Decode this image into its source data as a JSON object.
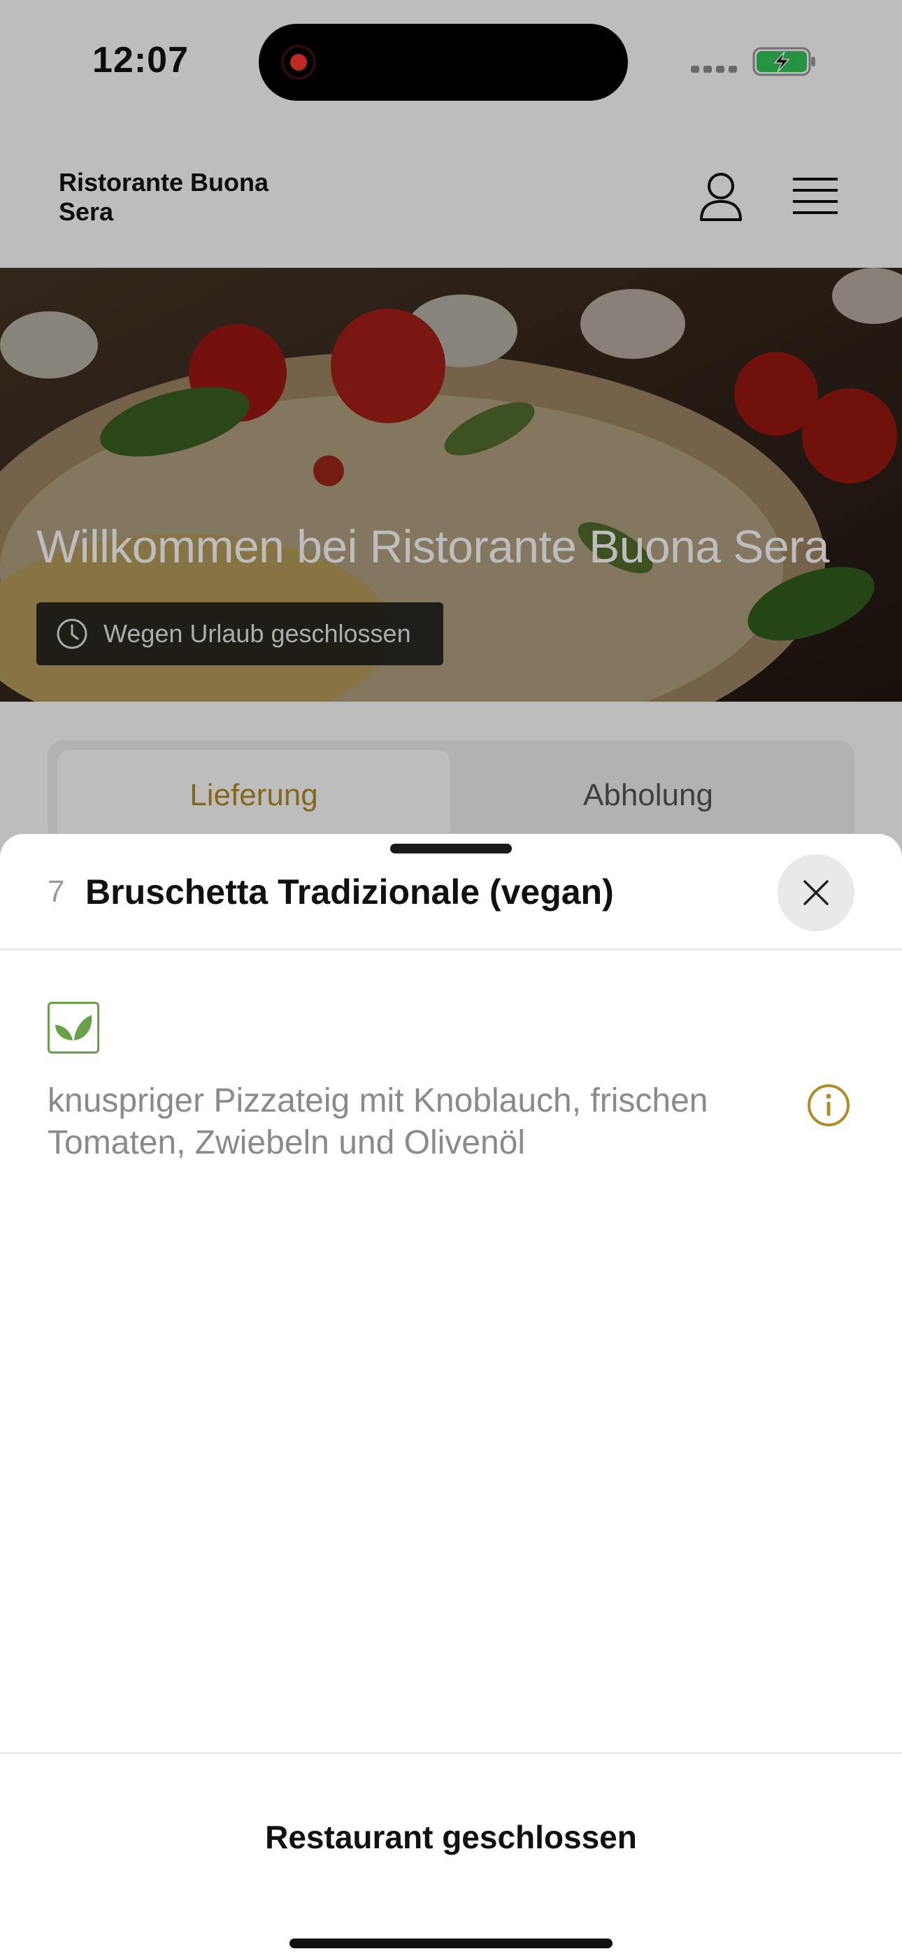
{
  "status_bar": {
    "time": "12:07"
  },
  "header": {
    "brand": "Ristorante Buona Sera",
    "user_icon": "person-icon",
    "menu_icon": "hamburger-icon"
  },
  "hero": {
    "title": "Willkommen bei Ristorante Buona Sera",
    "status_badge": "Wegen Urlaub geschlossen",
    "status_icon": "clock-icon"
  },
  "order_tabs": [
    {
      "label": "Lieferung",
      "selected": true
    },
    {
      "label": "Abholung",
      "selected": false
    }
  ],
  "sheet": {
    "item_number": "7",
    "item_title": "Bruschetta Tradizionale (vegan)",
    "close_icon": "close-icon",
    "badge_icon": "leaf-icon",
    "description": "knuspriger Pizzateig mit Knoblauch, frischen Tomaten, Zwiebeln und Olivenöl",
    "info_icon": "info-icon",
    "footer_label": "Restaurant geschlossen"
  },
  "colors": {
    "accent": "#b08d27",
    "vegan_green": "#6aa04a",
    "overlay": "rgba(0,0,0,0.26)"
  }
}
